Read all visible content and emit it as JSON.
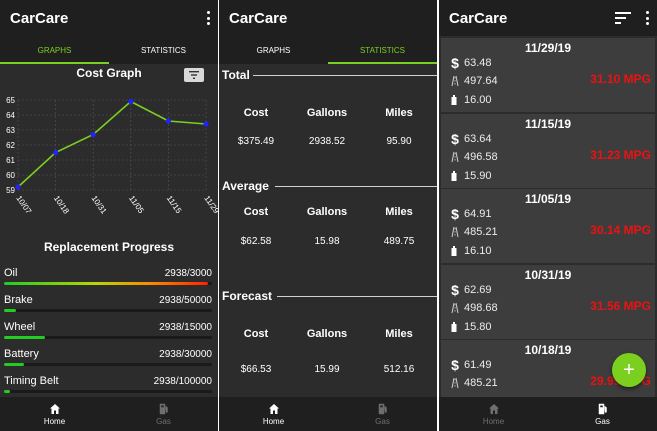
{
  "app_title": "CarCare",
  "tabs": [
    {
      "label": "GRAPHS"
    },
    {
      "label": "STATISTICS"
    }
  ],
  "bottom_nav": [
    {
      "label": "Home"
    },
    {
      "label": "Gas"
    }
  ],
  "graph_title": "Cost Graph",
  "replacement": {
    "title": "Replacement Progress",
    "items": [
      {
        "label": "Oil",
        "value": "2938/3000",
        "progress": 0.979
      },
      {
        "label": "Brake",
        "value": "2938/50000",
        "progress": 0.059
      },
      {
        "label": "Wheel",
        "value": "2938/15000",
        "progress": 0.196
      },
      {
        "label": "Battery",
        "value": "2938/30000",
        "progress": 0.098
      },
      {
        "label": "Timing Belt",
        "value": "2938/100000",
        "progress": 0.029
      }
    ]
  },
  "statistics": {
    "headers": [
      "Cost",
      "Gallons",
      "Miles"
    ],
    "sections": [
      {
        "label": "Total",
        "values": [
          "$375.49",
          "2938.52",
          "95.90"
        ]
      },
      {
        "label": "Average",
        "values": [
          "$62.58",
          "15.98",
          "489.75"
        ]
      },
      {
        "label": "Forecast",
        "values": [
          "$66.53",
          "15.99",
          "512.16"
        ]
      }
    ]
  },
  "gas_entries": [
    {
      "date": "11/29/19",
      "cost": "63.48",
      "miles": "497.64",
      "gallons": "16.00",
      "mpg": "31.10 MPG"
    },
    {
      "date": "11/15/19",
      "cost": "63.64",
      "miles": "496.58",
      "gallons": "15.90",
      "mpg": "31.23 MPG"
    },
    {
      "date": "11/05/19",
      "cost": "64.91",
      "miles": "485.21",
      "gallons": "16.10",
      "mpg": "30.14 MPG"
    },
    {
      "date": "10/31/19",
      "cost": "62.69",
      "miles": "498.68",
      "gallons": "15.80",
      "mpg": "31.56 MPG"
    },
    {
      "date": "10/18/19",
      "cost": "61.49",
      "miles": "485.21",
      "gallons": "",
      "mpg": "29.99 MPG"
    }
  ],
  "symbols": {
    "dollar": "$",
    "fab_plus": "+"
  },
  "icons": {
    "menu": "more-vert-icon",
    "sort": "sort-icon",
    "filter": "filter-icon",
    "home": "home-icon",
    "gas": "gas-station-icon",
    "road": "road-icon",
    "pump": "fuel-pump-icon",
    "add": "add-icon"
  },
  "colors": {
    "accent": "#7bd01f",
    "mpg": "#ee1111",
    "line": "#7bd01f",
    "point": "#2222ff",
    "progress": "#22cc22"
  },
  "chart_data": {
    "type": "line",
    "categories": [
      "10/07",
      "10/18",
      "10/31",
      "11/05",
      "11/15",
      "11/29"
    ],
    "values": [
      59.2,
      61.5,
      62.7,
      64.9,
      63.6,
      63.4
    ],
    "title": "Cost Graph",
    "xlabel": "",
    "ylabel": "",
    "ylim": [
      59,
      65
    ],
    "yticks": [
      59,
      60,
      61,
      62,
      63,
      64,
      65
    ],
    "grid": true
  }
}
